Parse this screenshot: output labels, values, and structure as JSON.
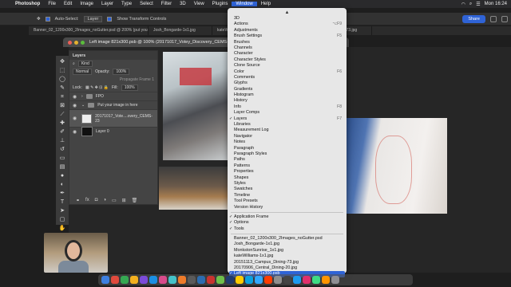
{
  "menubar": {
    "app_name": "Photoshop",
    "items": [
      "File",
      "Edit",
      "Image",
      "Layer",
      "Type",
      "Select",
      "Filter",
      "3D",
      "View",
      "Plugins",
      "Window",
      "Help"
    ],
    "active_item": "Window",
    "clock": "Mon 16:24"
  },
  "options_bar": {
    "auto_select_label": "Auto-Select:",
    "auto_select_value": "Layer",
    "transform_label": "Show Transform Controls",
    "share_label": "Share"
  },
  "tabs": [
    "Banner_02_1200x300_2Images_noGutter.psd @ 200% (put your image in here, RGB/8)",
    "Josh_Bongarde-1x1.jpg",
    "kateWilliams-1x1.jpg @ 66.7%",
    "20151113_Campus_Dining-73.jpg"
  ],
  "doc_window": {
    "title": "Left image 821x300.psb @ 100% (20171017_Votey_Discovery_CEMS-23, RGB/8)"
  },
  "layers_panel": {
    "title": "Layers",
    "kind": "Kind",
    "blend_mode": "Normal",
    "opacity_label": "Opacity:",
    "opacity_value": "100%",
    "propagate_label": "Propagate Frame 1",
    "lock_label": "Lock:",
    "fill_label": "Fill:",
    "fill_value": "100%",
    "layers": [
      {
        "name": "FPO",
        "type": "folder"
      },
      {
        "name": "Put your image in here",
        "type": "folder"
      },
      {
        "name": "20171017_Vote....overy_CEMS-23",
        "type": "image"
      },
      {
        "name": "Layer 0",
        "type": "layer"
      }
    ]
  },
  "window_menu": {
    "items": [
      {
        "label": "3D"
      },
      {
        "label": "Actions",
        "shortcut": "⌥F9"
      },
      {
        "label": "Adjustments"
      },
      {
        "label": "Brush Settings",
        "shortcut": "F5"
      },
      {
        "label": "Brushes"
      },
      {
        "label": "Channels"
      },
      {
        "label": "Character"
      },
      {
        "label": "Character Styles"
      },
      {
        "label": "Clone Source"
      },
      {
        "label": "Color",
        "shortcut": "F6"
      },
      {
        "label": "Comments"
      },
      {
        "label": "Glyphs"
      },
      {
        "label": "Gradients"
      },
      {
        "label": "Histogram"
      },
      {
        "label": "History"
      },
      {
        "label": "Info",
        "shortcut": "F8"
      },
      {
        "label": "Layer Comps"
      },
      {
        "label": "Layers",
        "shortcut": "F7",
        "checked": true
      },
      {
        "label": "Libraries"
      },
      {
        "label": "Measurement Log"
      },
      {
        "label": "Navigator"
      },
      {
        "label": "Notes"
      },
      {
        "label": "Paragraph"
      },
      {
        "label": "Paragraph Styles"
      },
      {
        "label": "Paths"
      },
      {
        "label": "Patterns"
      },
      {
        "label": "Properties"
      },
      {
        "label": "Shapes"
      },
      {
        "label": "Styles"
      },
      {
        "label": "Swatches"
      },
      {
        "label": "Timeline"
      },
      {
        "label": "Tool Presets"
      },
      {
        "label": "Version History"
      },
      {
        "separator": true
      },
      {
        "label": "Application Frame",
        "checked": true
      },
      {
        "label": "Options",
        "checked": true
      },
      {
        "label": "Tools",
        "checked": true
      },
      {
        "separator": true
      },
      {
        "label": "Banner_02_1200x300_2Images_noGutter.psd"
      },
      {
        "label": "Josh_Bongarde-1x1.jpg"
      },
      {
        "label": "MonkstonSunrise_1x1.jpg"
      },
      {
        "label": "kateWilliams-1x1.jpg"
      },
      {
        "label": "20151113_Campus_Dining-73.jpg"
      },
      {
        "label": "20170906_Central_Dining-20.jpg"
      },
      {
        "label": "Left image 821x300.psb",
        "checked": true,
        "highlighted": true
      }
    ]
  },
  "colors": {
    "accent": "#2f63d6",
    "menu_bg": "#e7e7e7",
    "app_bg": "#1e1e1e"
  }
}
